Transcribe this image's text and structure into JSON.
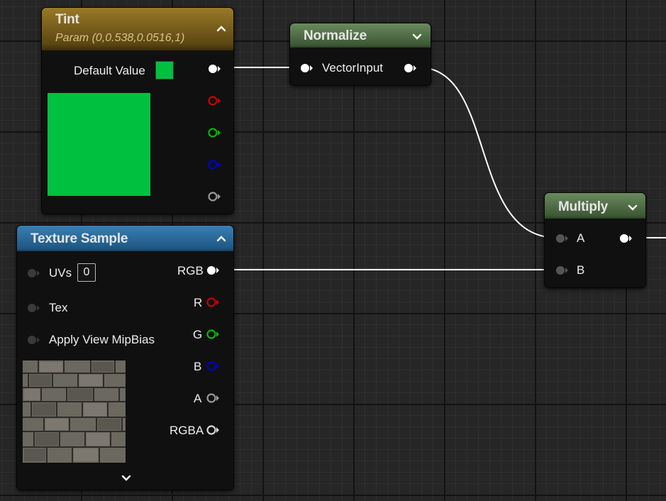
{
  "colors": {
    "tint_color": "#00c040",
    "tint_header": "#8a6a1e",
    "normalize_header": "#4d6f44",
    "multiply_header": "#4d6f44",
    "texture_header": "#1f5a86",
    "pin_white": "#ffffff",
    "pin_red": "#cc0000",
    "pin_green": "#00bb00",
    "pin_blue": "#0000cc",
    "pin_gray": "#9a9a9a"
  },
  "tint": {
    "title": "Tint",
    "subtitle": "Param (0,0.538,0.0516,1)",
    "default_value_label": "Default Value"
  },
  "normalize": {
    "title": "Normalize",
    "input_label": "VectorInput"
  },
  "multiply": {
    "title": "Multiply",
    "input_a": "A",
    "input_b": "B"
  },
  "texture_sample": {
    "title": "Texture Sample",
    "inputs": {
      "uvs": "UVs",
      "uvs_value": "0",
      "tex": "Tex",
      "mipbias": "Apply View MipBias"
    },
    "outputs": {
      "rgb": "RGB",
      "r": "R",
      "g": "G",
      "b": "B",
      "a": "A",
      "rgba": "RGBA"
    }
  },
  "icons": {
    "collapse": "chevron-up-icon",
    "expand": "chevron-down-icon",
    "output_pin": "pin-icon"
  }
}
